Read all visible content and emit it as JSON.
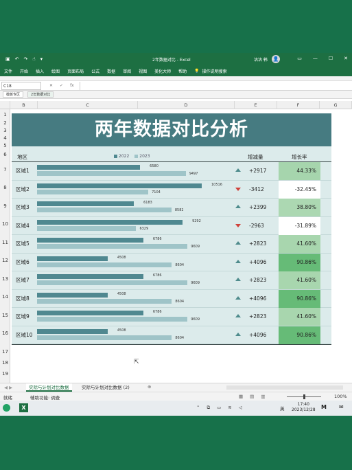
{
  "window": {
    "doc_title": "2年数据对比 - Excel",
    "user_name": "沽沽 韩",
    "avatar_glyph": "👤"
  },
  "ribbon_tabs": [
    "文件",
    "开始",
    "插入",
    "绘图",
    "页面布局",
    "公式",
    "数据",
    "审阅",
    "视图",
    "美化大师",
    "帮助"
  ],
  "ribbon_search": "操作说明搜索",
  "formula_bar": {
    "name_box": "C18",
    "fx_label": "fx",
    "formula": ""
  },
  "file_tabs": [
    "模板专区",
    "2年数据对比"
  ],
  "column_headers": [
    "B",
    "C",
    "D",
    "E",
    "F",
    "G"
  ],
  "row_headers": [
    "1",
    "2",
    "3",
    "4",
    "5",
    "6",
    "7",
    "8",
    "9",
    "10",
    "11",
    "12",
    "13",
    "14",
    "15",
    "16",
    "17",
    "18",
    "19"
  ],
  "dashboard": {
    "title": "两年数据对比分析",
    "col_region": "地区",
    "col_delta": "增减量",
    "col_rate": "增长率",
    "legend": [
      {
        "name": "2022",
        "color": "#4f8890"
      },
      {
        "name": "2023",
        "color": "#9fc4c8"
      }
    ],
    "bar_max": 10516,
    "rows": [
      {
        "region": "区域1",
        "v2022": 6580,
        "v2023": 9497,
        "delta": "+2917",
        "rate": "44.33%",
        "trend": "up",
        "rate_color": "#a6d5ad"
      },
      {
        "region": "区域2",
        "v2022": 10516,
        "v2023": 7104,
        "delta": "-3412",
        "rate": "-32.45%",
        "trend": "down",
        "rate_color": "#ffffff"
      },
      {
        "region": "区域3",
        "v2022": 6183,
        "v2023": 8582,
        "delta": "+2399",
        "rate": "38.80%",
        "trend": "up",
        "rate_color": "#acd8b2"
      },
      {
        "region": "区域4",
        "v2022": 9292,
        "v2023": 6329,
        "delta": "-2963",
        "rate": "-31.89%",
        "trend": "down",
        "rate_color": "#ffffff"
      },
      {
        "region": "区域5",
        "v2022": 6786,
        "v2023": 9609,
        "delta": "+2823",
        "rate": "41.60%",
        "trend": "up",
        "rate_color": "#a8d6ae"
      },
      {
        "region": "区域6",
        "v2022": 4508,
        "v2023": 8604,
        "delta": "+4096",
        "rate": "90.86%",
        "trend": "up",
        "rate_color": "#66bb77"
      },
      {
        "region": "区域7",
        "v2022": 6786,
        "v2023": 9609,
        "delta": "+2823",
        "rate": "41.60%",
        "trend": "up",
        "rate_color": "#a8d6ae"
      },
      {
        "region": "区域8",
        "v2022": 4508,
        "v2023": 8604,
        "delta": "+4096",
        "rate": "90.86%",
        "trend": "up",
        "rate_color": "#66bb77"
      },
      {
        "region": "区域9",
        "v2022": 6786,
        "v2023": 9609,
        "delta": "+2823",
        "rate": "41.60%",
        "trend": "up",
        "rate_color": "#a8d6ae"
      },
      {
        "region": "区域10",
        "v2022": 4508,
        "v2023": 8604,
        "delta": "+4096",
        "rate": "90.86%",
        "trend": "up",
        "rate_color": "#66bb77"
      }
    ]
  },
  "sheet_tabs": [
    "实际与计划对比数据",
    "实际与计划对比数据 (2)"
  ],
  "status": {
    "ready": "就绪",
    "accessibility": "辅助功能: 调查",
    "zoom": "100%"
  },
  "taskbar": {
    "lang": "英",
    "time": "17:40",
    "date": "2023/12/28",
    "excel_glyph": "X",
    "mi_glyph": "M"
  }
}
